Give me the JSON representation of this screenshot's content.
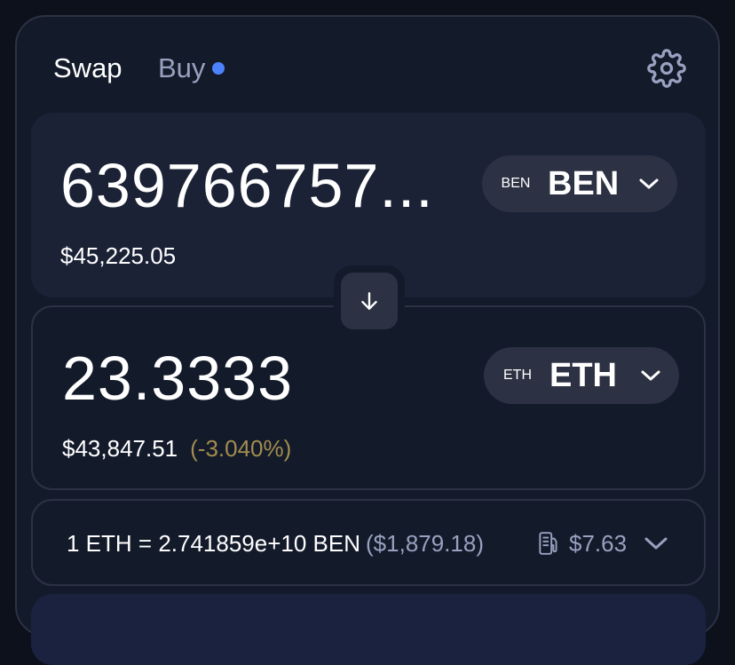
{
  "tabs": {
    "swap": "Swap",
    "buy": "Buy"
  },
  "icons": {
    "settings": "gear-icon",
    "switch": "arrow-down-icon",
    "token_dropdown": "chevron-down-icon",
    "gas": "gas-pump-icon",
    "details": "chevron-down-icon"
  },
  "input_token": {
    "amount": "639766757...",
    "usd_value": "$45,225.05",
    "logo_text": "BEN",
    "symbol": "BEN"
  },
  "output_token": {
    "amount": "23.3333",
    "usd_value": "$43,847.51",
    "price_impact": "(-3.040%)",
    "logo_text": "ETH",
    "symbol": "ETH"
  },
  "rate": {
    "text": "1 ETH = 2.741859e+10 BEN",
    "usd": "($1,879.18)",
    "gas_cost": "$7.63"
  },
  "colors": {
    "background": "#0d111c",
    "card": "#131a2a",
    "panel": "#1b2236",
    "border": "#2c3243",
    "accent_dot": "#4c82fb",
    "muted_text": "#98a1c0",
    "warning_text": "#a28c4f"
  }
}
